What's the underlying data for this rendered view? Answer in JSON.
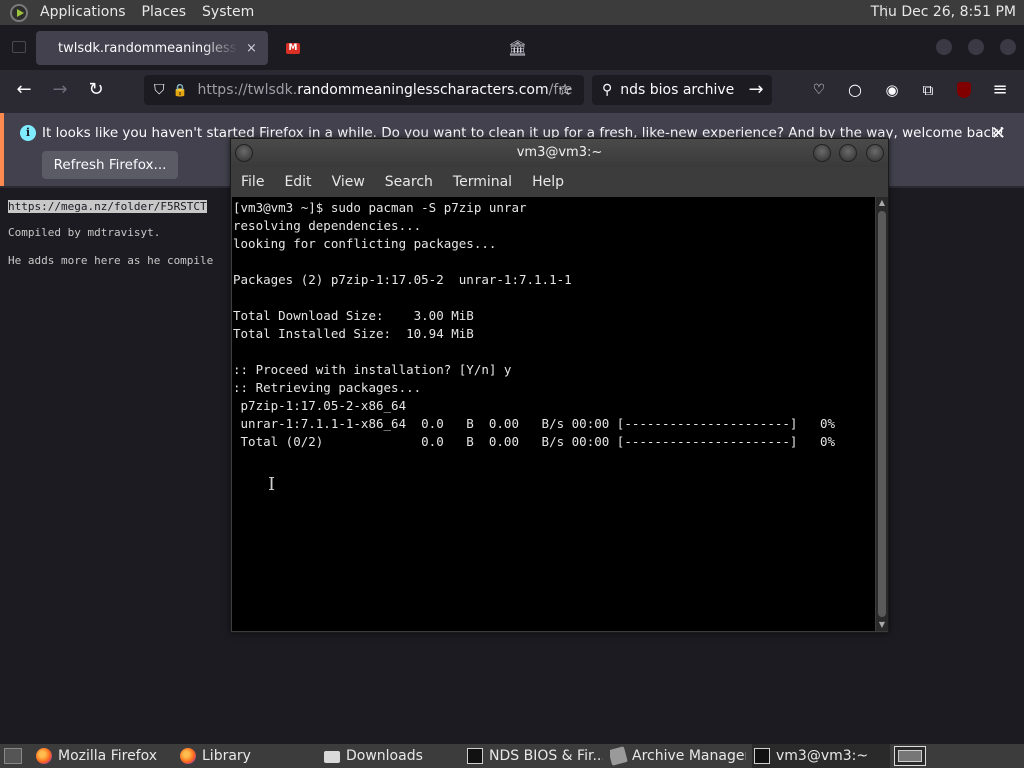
{
  "top_panel": {
    "menus": [
      "Applications",
      "Places",
      "System"
    ],
    "clock": "Thu Dec 26,  8:51 PM"
  },
  "firefox": {
    "tabs": [
      {
        "title": "twlsdk.randommeaninglesscha",
        "close": "×"
      },
      {
        "title": ""
      },
      {
        "title": ""
      }
    ],
    "url_host": "https://twlsdk.",
    "url_domain": "randommeaninglesscharacters.com",
    "url_path": "/fre",
    "search_value": "nds bios archive",
    "notification": {
      "message": "It looks like you haven't started Firefox in a while. Do you want to clean it up for a fresh, like-new experience? And by the way, welcome back!",
      "button_label": "Refresh Firefox...",
      "info_glyph": "i",
      "close": "✕"
    },
    "page_lines": [
      "https://mega.nz/folder/F5RSTCT",
      "Compiled by mdtravisyt.",
      "He adds more here as he compile"
    ]
  },
  "terminal": {
    "title": "vm3@vm3:~",
    "menu": [
      "File",
      "Edit",
      "View",
      "Search",
      "Terminal",
      "Help"
    ],
    "output": "[vm3@vm3 ~]$ sudo pacman -S p7zip unrar\nresolving dependencies...\nlooking for conflicting packages...\n\nPackages (2) p7zip-1:17.05-2  unrar-1:7.1.1-1\n\nTotal Download Size:    3.00 MiB\nTotal Installed Size:  10.94 MiB\n\n:: Proceed with installation? [Y/n] y\n:: Retrieving packages...\n p7zip-1:17.05-2-x86_64\n unrar-1:7.1.1-1-x86_64  0.0   B  0.00   B/s 00:00 [----------------------]   0%\n Total (0/2)             0.0   B  0.00   B/s 00:00 [----------------------]   0%"
  },
  "taskbar": {
    "items": [
      {
        "label": "Mozilla Firefox",
        "icon": "firefox-icon"
      },
      {
        "label": "Library",
        "icon": "firefox-icon"
      },
      {
        "label": "Downloads",
        "icon": "folder-icon"
      },
      {
        "label": "NDS BIOS & Fir...",
        "icon": "terminal-icon"
      },
      {
        "label": "Archive Manager",
        "icon": "archive-icon"
      },
      {
        "label": "vm3@vm3:~",
        "icon": "terminal-icon"
      }
    ]
  },
  "colors": {
    "panel": "#3c3c3c",
    "firefox_bg": "#2b2a33",
    "notification_accent": "#ff8a50",
    "terminal_bg": "#000000"
  }
}
